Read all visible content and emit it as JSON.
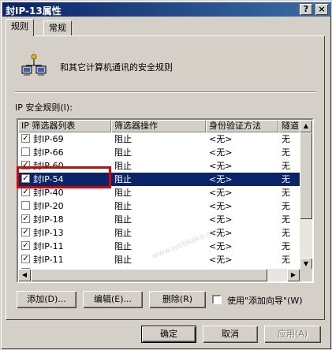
{
  "window": {
    "title": "封IP-13属性",
    "help_glyph": "?",
    "close_glyph": "×"
  },
  "tabs": [
    {
      "label": "规则"
    },
    {
      "label": "常规"
    }
  ],
  "description": "和其它计算机通讯的安全规则",
  "list_label": "IP 安全规则(I):",
  "columns": [
    "IP 筛选器列表",
    "筛选器操作",
    "身份验证方法",
    "隧道"
  ],
  "rows": [
    {
      "checked": true,
      "name": "封IP-69",
      "action": "阻止",
      "auth": "<无>",
      "tunnel": "无"
    },
    {
      "checked": false,
      "name": "封IP-66",
      "action": "阻止",
      "auth": "<无>",
      "tunnel": "无"
    },
    {
      "checked": true,
      "name": "封IP-60",
      "action": "阻止",
      "auth": "<无>",
      "tunnel": "无"
    },
    {
      "checked": true,
      "name": "封IP-54",
      "action": "阻止",
      "auth": "<无>",
      "tunnel": "无",
      "selected": true
    },
    {
      "checked": true,
      "name": "封IP-40",
      "action": "阻止",
      "auth": "<无>",
      "tunnel": "无"
    },
    {
      "checked": false,
      "name": "封IP-20",
      "action": "阻止",
      "auth": "<无>",
      "tunnel": "无"
    },
    {
      "checked": true,
      "name": "封IP-18",
      "action": "阻止",
      "auth": "<无>",
      "tunnel": "无"
    },
    {
      "checked": true,
      "name": "封IP-13",
      "action": "阻止",
      "auth": "<无>",
      "tunnel": "无"
    },
    {
      "checked": true,
      "name": "封IP-11",
      "action": "阻止",
      "auth": "<无>",
      "tunnel": "无"
    },
    {
      "checked": true,
      "name": "封IP-11",
      "action": "阻止",
      "auth": "<无>",
      "tunnel": "无"
    },
    {
      "checked": true,
      "name": "封IP-44",
      "action": "阻止",
      "auth": "<无>",
      "tunnel": "无"
    }
  ],
  "buttons": {
    "add": "添加(D)...",
    "edit": "编辑(E)...",
    "delete": "删除(R)",
    "use_wizard": "使用\"添加向导\"(W)",
    "ok": "确定",
    "cancel": "取消",
    "apply": "应用(A)"
  },
  "watermark": "www.webkaka.com",
  "colors": {
    "selection": "#0a246a",
    "highlight_box": "#e00000"
  },
  "icons": {
    "network": "network-computers-icon",
    "checkmark": "✓"
  }
}
